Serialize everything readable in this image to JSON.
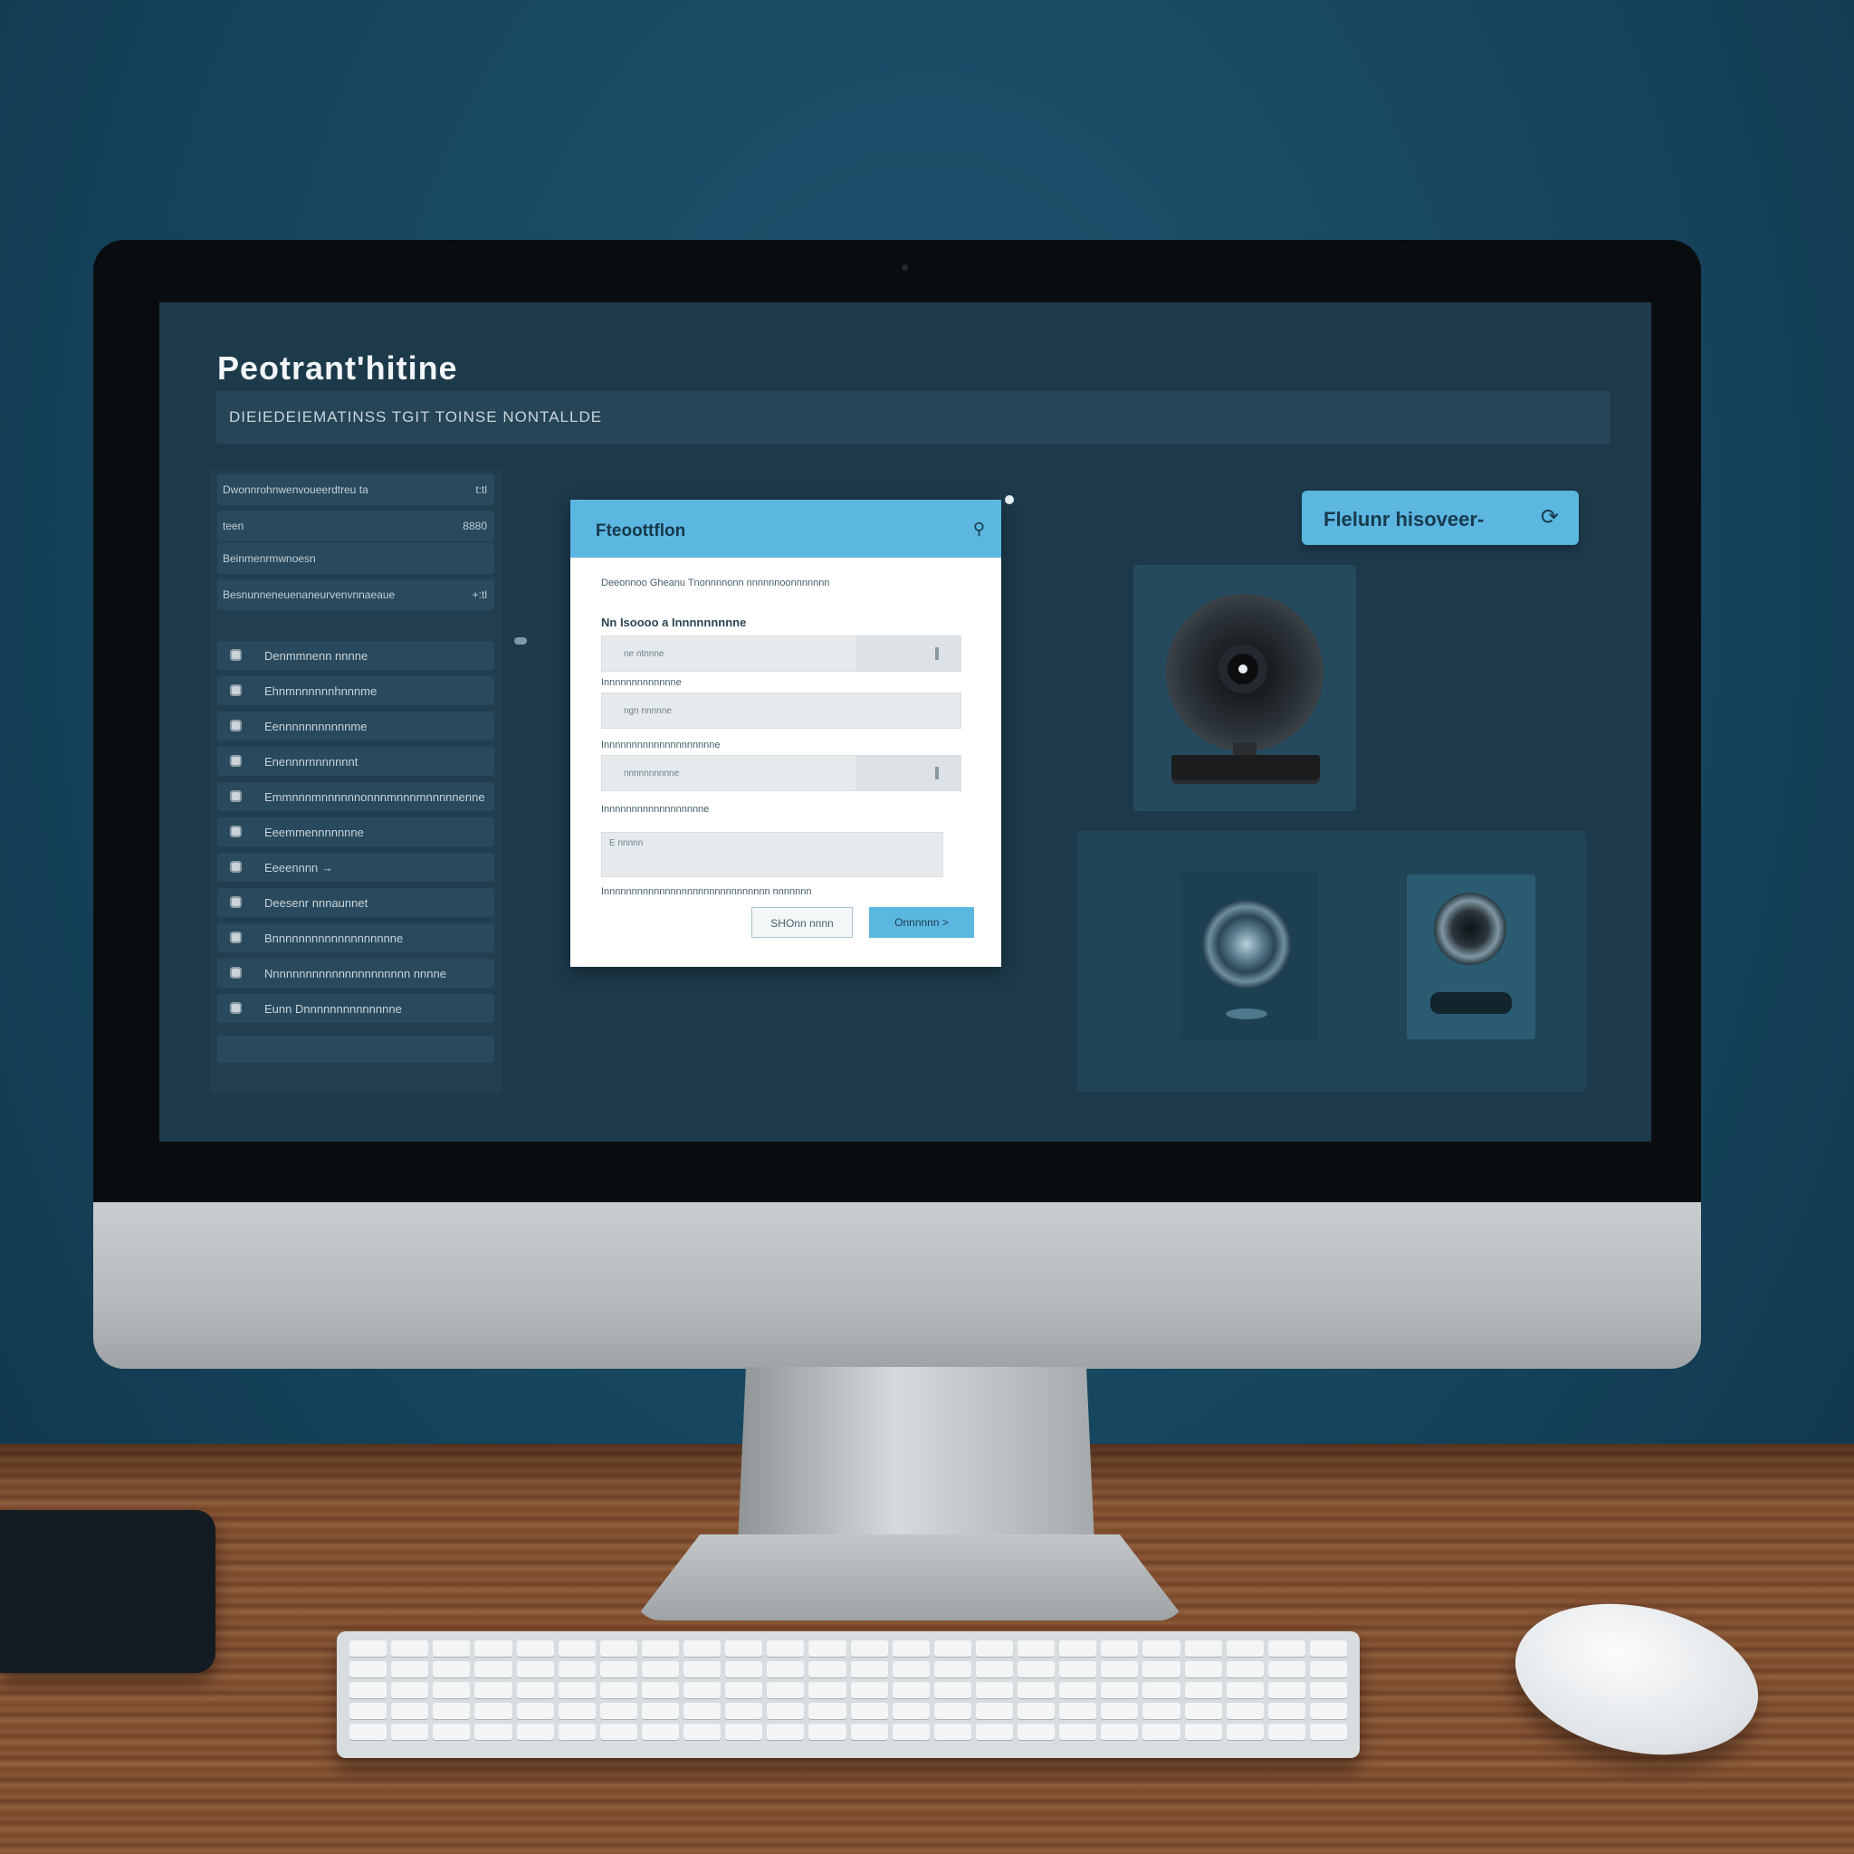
{
  "app": {
    "title": "Peotrant'hitine",
    "path_bar": "DIEIEDEIEMATINSS TGIT TOINSE  NONTALLDE"
  },
  "sidebar": {
    "summary_rows": [
      {
        "label": "Dwonnrohnwenvoueerdtreu ta",
        "value": "t:tl"
      },
      {
        "label": "teen",
        "value": "8880"
      },
      {
        "label": "Beinmenrmwnoesn",
        "value": ""
      },
      {
        "label": "Besnunneneuenaneurvenvnnaeaue",
        "value": "+:tl"
      }
    ],
    "list_items": [
      "Denmmnenn nnnne",
      "Ehnmnnnnnnhnnnme",
      "Eennnnnnnnnnnme",
      "Enennnrnnnnnnnt",
      "Emmnnnmnnnnnnonnnmnnnmnnnnnenne",
      "Eeemmennnnnnne",
      "Eeeennnn  →",
      "Deesenr nnnaunnet",
      "Bnnnnnnnnnnnnnnnnnnne",
      "Nnnnnnnnnnnnnnnnnnnnnn nnnne",
      "Eunn  Dnnnnnnnnnnnnnne"
    ]
  },
  "dialog": {
    "title": "Fteoottflon",
    "top_line": "Deeonnoo  Gheanu  Tnonnnnonn nnnnnnoonnnnnnn",
    "section_label": "Nn  Isoooo  a  Innnnnnnnne",
    "fields": [
      {
        "label": "",
        "value": "ne  ntnnne"
      },
      {
        "label": "Innnnnnnnnnnnne",
        "value": "ngn  nnnnne"
      },
      {
        "label": "Innnnnnnnnnnnnnnnnnnne",
        "value": "nnnnnnnnnne"
      },
      {
        "label": "Innnnnnnnnnnnnnnnnne",
        "value": ""
      }
    ],
    "textarea_label": "E  nnnnn",
    "footer_text": "Innnnnnnnnnnnnnnnnnnnnnnnnnnnnn  nnnnnnn",
    "secondary_button": "SHOnn   nnnn",
    "primary_button": "Onnnnnn  >"
  },
  "action": {
    "label": "Flelunr hisoveer-",
    "icon": "refresh-icon"
  },
  "colors": {
    "accent": "#5bb6e0",
    "screen_bg": "#1d3a4b",
    "wall": "#16455d"
  }
}
